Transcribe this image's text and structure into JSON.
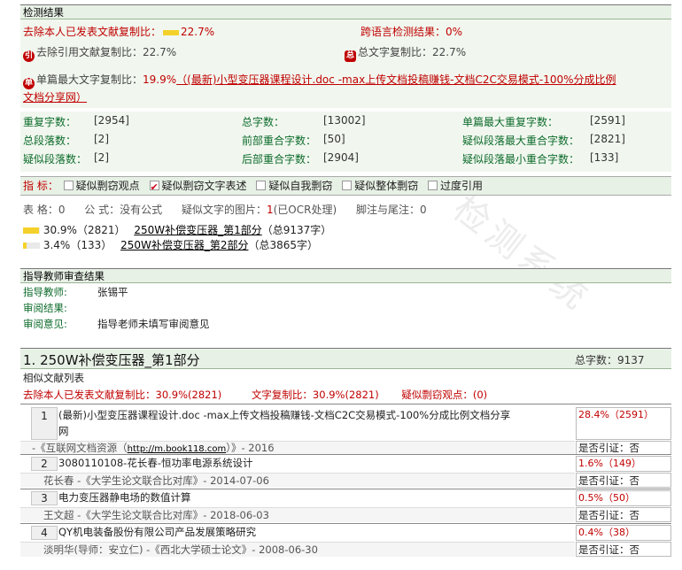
{
  "detect": {
    "header": "检测结果",
    "excl_self_label": "去除本人已发表文献复制比：",
    "excl_self_value": "22.7%",
    "cross_lang_label": "跨语言检测结果：",
    "cross_lang_value": "0%",
    "excl_ref_icon": "引",
    "excl_ref_label": "去除引用文献复制比：",
    "excl_ref_value": "22.7%",
    "total_icon": "总",
    "total_label": "总文字复制比：",
    "total_value": "22.7%",
    "single_icon": "单",
    "single_label": "单篇最大文字复制比：",
    "single_value": "19.9%",
    "single_source_line1": "（(最新)小型变压器课程设计.doc -max上传文档投稿赚钱-文档C2C交易模式-100%分成比例",
    "single_source_line2": "文档分享网）"
  },
  "stats": [
    [
      {
        "label": "重复字数：",
        "value": "[2954]"
      },
      {
        "label": "总字数：",
        "value": "[13002]"
      },
      {
        "label": "单篇最大重复字数：",
        "value": "[2591]"
      }
    ],
    [
      {
        "label": "总段落数：",
        "value": "[2]"
      },
      {
        "label": "前部重合字数：",
        "value": "[50]"
      },
      {
        "label": "疑似段落最大重合字数：",
        "value": "[2821]"
      }
    ],
    [
      {
        "label": "疑似段落数：",
        "value": "[2]"
      },
      {
        "label": "后部重合字数：",
        "value": "[2904]"
      },
      {
        "label": "疑似段落最小重合字数：",
        "value": "[133]"
      }
    ]
  ],
  "indicators": {
    "label": "指  标：",
    "items": [
      "疑似剽窃观点",
      "疑似剽窃文字表述",
      "疑似自我剽窃",
      "疑似整体剽窃",
      "过度引用"
    ],
    "checked": [
      false,
      true,
      false,
      false,
      false
    ]
  },
  "info": {
    "tables": "表 格：0",
    "formulas": "公 式：没有公式",
    "images_label": "疑似文字的图片：",
    "images_value": "1",
    "images_note": "(已OCR处理)",
    "footnotes": "脚注与尾注：0"
  },
  "parts": [
    {
      "pct": "30.9%（2821）",
      "name": "250W补偿变压器_第1部分",
      "total": "（总9137字）",
      "fill": 30.9
    },
    {
      "pct": "3.4%（133）",
      "name": "250W补偿变压器_第2部分",
      "total": "（总3865字）",
      "fill": 3.4
    }
  ],
  "review": {
    "header": "指导教师审查结果",
    "teacher_label": "指导教师:",
    "teacher_name": "张锡平",
    "result_label": "审阅结果:",
    "opinion_label": "审阅意见:",
    "opinion_value": "指导老师未填写审阅意见"
  },
  "section": {
    "title": "1. 250W补偿变压器_第1部分",
    "total_label": "总字数：9137",
    "similar_header": "相似文献列表",
    "excl_self": "去除本人已发表文献复制比：30.9%(2821)",
    "text_copy": "文字复制比：30.9%(2821)",
    "plag_view": "疑似剽窃观点：(0)"
  },
  "references": [
    {
      "num": "1",
      "title_line1": "(最新)小型变压器课程设计.doc -max上传文档投稿赚钱-文档C2C交易模式-100%分成比例文档分享",
      "title_line2": "网",
      "pct": "28.4%（2591）",
      "source_pre": "-《互联网文档资源（",
      "source_link": "http://m.book118.com",
      "source_post": "）》- 2016",
      "cite": "是否引证：否"
    },
    {
      "num": "2",
      "title_line1": "3080110108-花长春-恒功率电源系统设计",
      "pct": "1.6%（149）",
      "source": "花长春 -《大学生论文联合比对库》- 2014-07-06",
      "cite": "是否引证：否"
    },
    {
      "num": "3",
      "title_line1": "电力变压器静电场的数值计算",
      "pct": "0.5%（50）",
      "source": "王文超 -《大学生论文联合比对库》- 2018-06-03",
      "cite": "是否引证：否"
    },
    {
      "num": "4",
      "title_line1": "QY机电装备股份有限公司产品发展策略研究",
      "pct": "0.4%（38）",
      "source": "淡明华(导师：安立仁) -《西北大学硕士论文》- 2008-06-30",
      "cite": "是否引证：否"
    }
  ],
  "watermark": "检测系统",
  "colors": {
    "accent_red": "#c00000",
    "label_green": "#0d6b2b",
    "header_bg": "#e8f1e6",
    "bar_yellow": "#f4d12a"
  }
}
